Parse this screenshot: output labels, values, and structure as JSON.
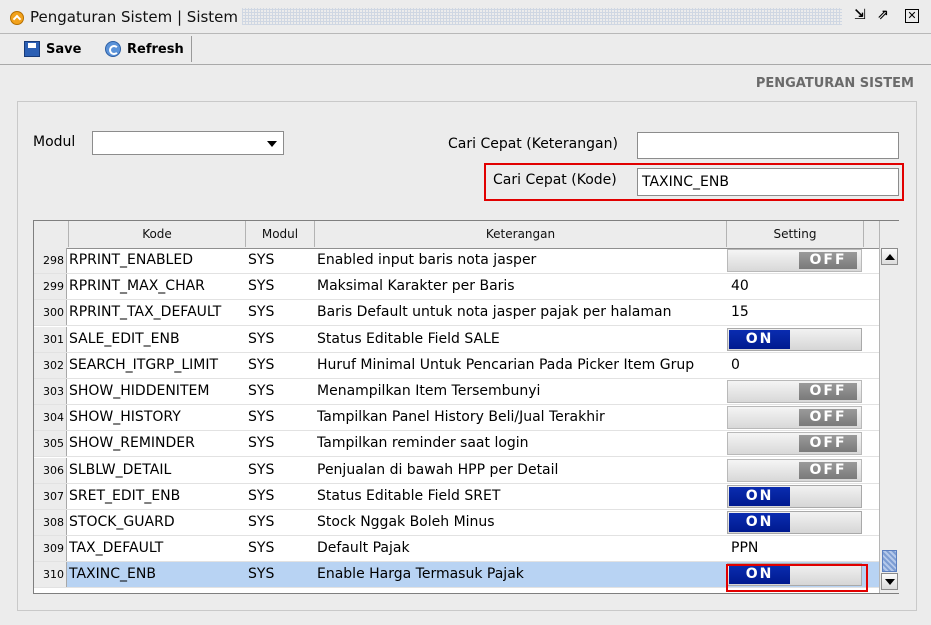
{
  "window": {
    "title": "Pengaturan Sistem | Sistem"
  },
  "toolbar": {
    "save_label": "Save",
    "refresh_label": "Refresh"
  },
  "page_heading": "PENGATURAN SISTEM",
  "filters": {
    "modul_label": "Modul",
    "modul_value": "",
    "cari_keterangan_label": "Cari Cepat (Keterangan)",
    "cari_keterangan_value": "",
    "cari_kode_label": "Cari Cepat (Kode)",
    "cari_kode_value": "TAXINC_ENB"
  },
  "table": {
    "columns": [
      "Kode",
      "Modul",
      "Keterangan",
      "Setting"
    ],
    "rows": [
      {
        "no": "298",
        "kode": "RPRINT_ENABLED",
        "modul": "SYS",
        "keterangan": "Enabled input baris nota jasper",
        "setting": "OFF",
        "type": "toggle"
      },
      {
        "no": "299",
        "kode": "RPRINT_MAX_CHAR",
        "modul": "SYS",
        "keterangan": "Maksimal Karakter per Baris",
        "setting": "40",
        "type": "text"
      },
      {
        "no": "300",
        "kode": "RPRINT_TAX_DEFAULT",
        "modul": "SYS",
        "keterangan": "Baris Default untuk nota jasper pajak per halaman",
        "setting": "15",
        "type": "text"
      },
      {
        "no": "301",
        "kode": "SALE_EDIT_ENB",
        "modul": "SYS",
        "keterangan": "Status Editable Field SALE",
        "setting": "ON",
        "type": "toggle"
      },
      {
        "no": "302",
        "kode": "SEARCH_ITGRP_LIMIT",
        "modul": "SYS",
        "keterangan": "Huruf Minimal Untuk Pencarian Pada Picker Item Grup",
        "setting": "0",
        "type": "text"
      },
      {
        "no": "303",
        "kode": "SHOW_HIDDENITEM",
        "modul": "SYS",
        "keterangan": "Menampilkan Item Tersembunyi",
        "setting": "OFF",
        "type": "toggle"
      },
      {
        "no": "304",
        "kode": "SHOW_HISTORY",
        "modul": "SYS",
        "keterangan": "Tampilkan Panel History Beli/Jual Terakhir",
        "setting": "OFF",
        "type": "toggle"
      },
      {
        "no": "305",
        "kode": "SHOW_REMINDER",
        "modul": "SYS",
        "keterangan": "Tampilkan reminder saat login",
        "setting": "OFF",
        "type": "toggle"
      },
      {
        "no": "306",
        "kode": "SLBLW_DETAIL",
        "modul": "SYS",
        "keterangan": "Penjualan di bawah HPP per Detail",
        "setting": "OFF",
        "type": "toggle"
      },
      {
        "no": "307",
        "kode": "SRET_EDIT_ENB",
        "modul": "SYS",
        "keterangan": "Status Editable Field SRET",
        "setting": "ON",
        "type": "toggle"
      },
      {
        "no": "308",
        "kode": "STOCK_GUARD",
        "modul": "SYS",
        "keterangan": "Stock Nggak Boleh Minus",
        "setting": "ON",
        "type": "toggle"
      },
      {
        "no": "309",
        "kode": "TAX_DEFAULT",
        "modul": "SYS",
        "keterangan": "Default Pajak",
        "setting": "PPN",
        "type": "text"
      },
      {
        "no": "310",
        "kode": "TAXINC_ENB",
        "modul": "SYS",
        "keterangan": "Enable Harga Termasuk Pajak",
        "setting": "ON",
        "type": "toggle",
        "selected": true
      }
    ]
  },
  "colors": {
    "highlight": "#e10000",
    "toggle_on": "#0a2cb0",
    "toggle_off": "#8a8a8a",
    "selected_row": "#b8d3f3"
  },
  "icons": [
    "app-icon",
    "restore-icon",
    "maximize-icon",
    "close-icon",
    "save-icon",
    "refresh-icon",
    "chevron-down-icon"
  ]
}
